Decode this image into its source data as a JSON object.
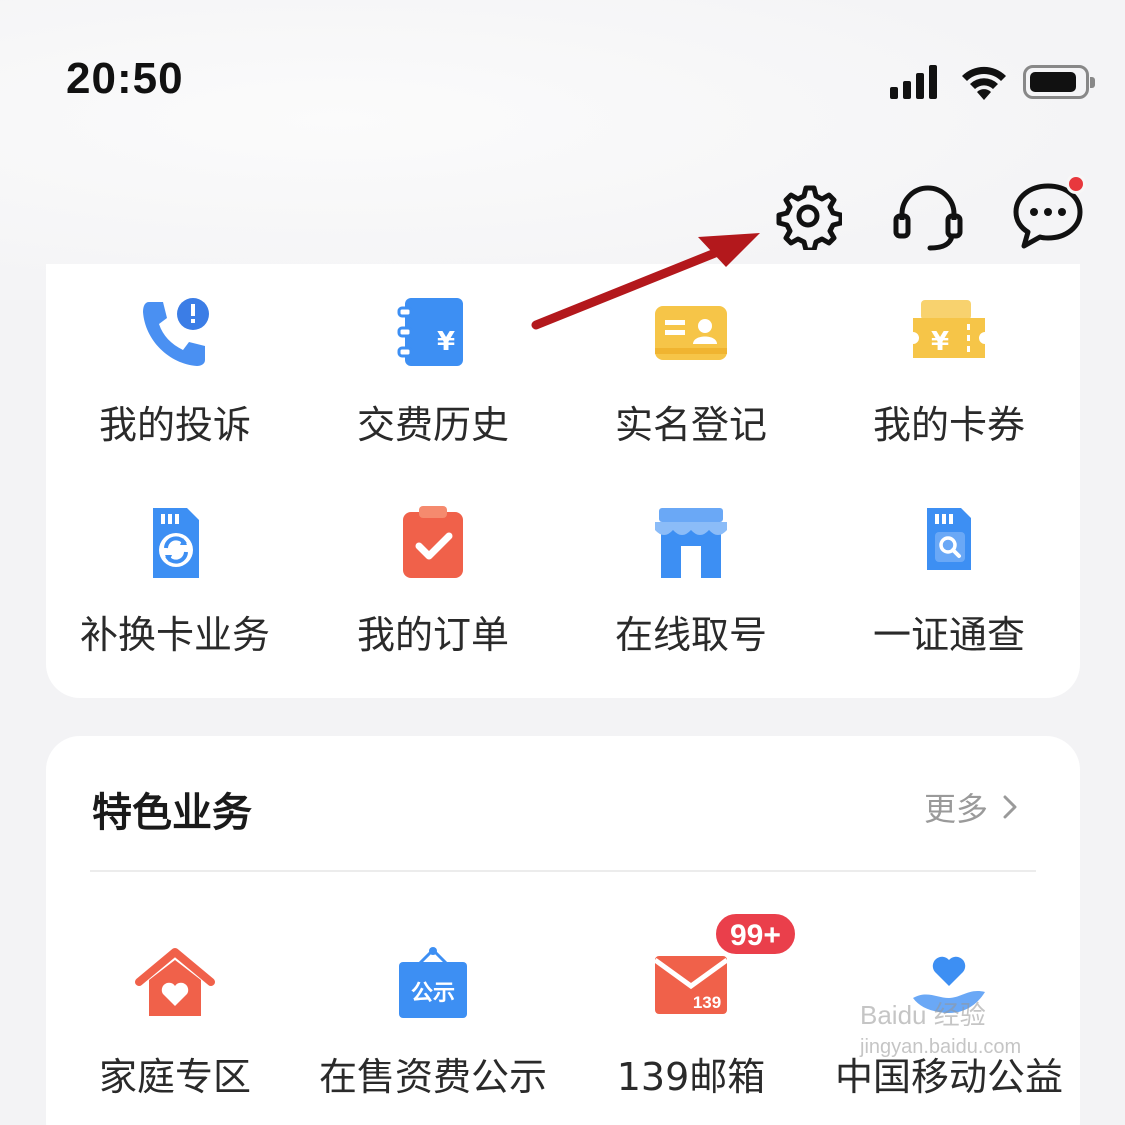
{
  "status_bar": {
    "time": "20:50"
  },
  "header": {
    "icons": [
      "settings-icon",
      "customer-service-icon",
      "message-icon"
    ],
    "message_has_unread": true
  },
  "services": {
    "items": [
      {
        "label": "我的投诉",
        "icon": "complaint-phone-icon"
      },
      {
        "label": "交费历史",
        "icon": "payment-history-icon"
      },
      {
        "label": "实名登记",
        "icon": "id-card-icon"
      },
      {
        "label": "我的卡券",
        "icon": "coupon-icon"
      },
      {
        "label": "补换卡业务",
        "icon": "sim-replace-icon"
      },
      {
        "label": "我的订单",
        "icon": "order-clipboard-icon"
      },
      {
        "label": "在线取号",
        "icon": "store-icon"
      },
      {
        "label": "一证通查",
        "icon": "sim-search-icon"
      }
    ]
  },
  "featured": {
    "title": "特色业务",
    "more_label": "更多",
    "items": [
      {
        "label": "家庭专区",
        "icon": "home-heart-icon"
      },
      {
        "label": "在售资费公示",
        "icon": "notice-board-icon",
        "icon_text": "公示"
      },
      {
        "label": "139邮箱",
        "icon": "mail-139-icon",
        "icon_text": "139",
        "badge": "99+"
      },
      {
        "label": "中国移动公益",
        "icon": "charity-heart-hand-icon"
      }
    ]
  },
  "watermark": {
    "text": "Baidu 经验",
    "sub": "jingyan.baidu.com"
  },
  "colors": {
    "accent_red": "#e8383d",
    "blue": "#3b8bf0",
    "yellow": "#f6c548",
    "orange_red": "#f0614a",
    "arrow": "#b3181c"
  }
}
